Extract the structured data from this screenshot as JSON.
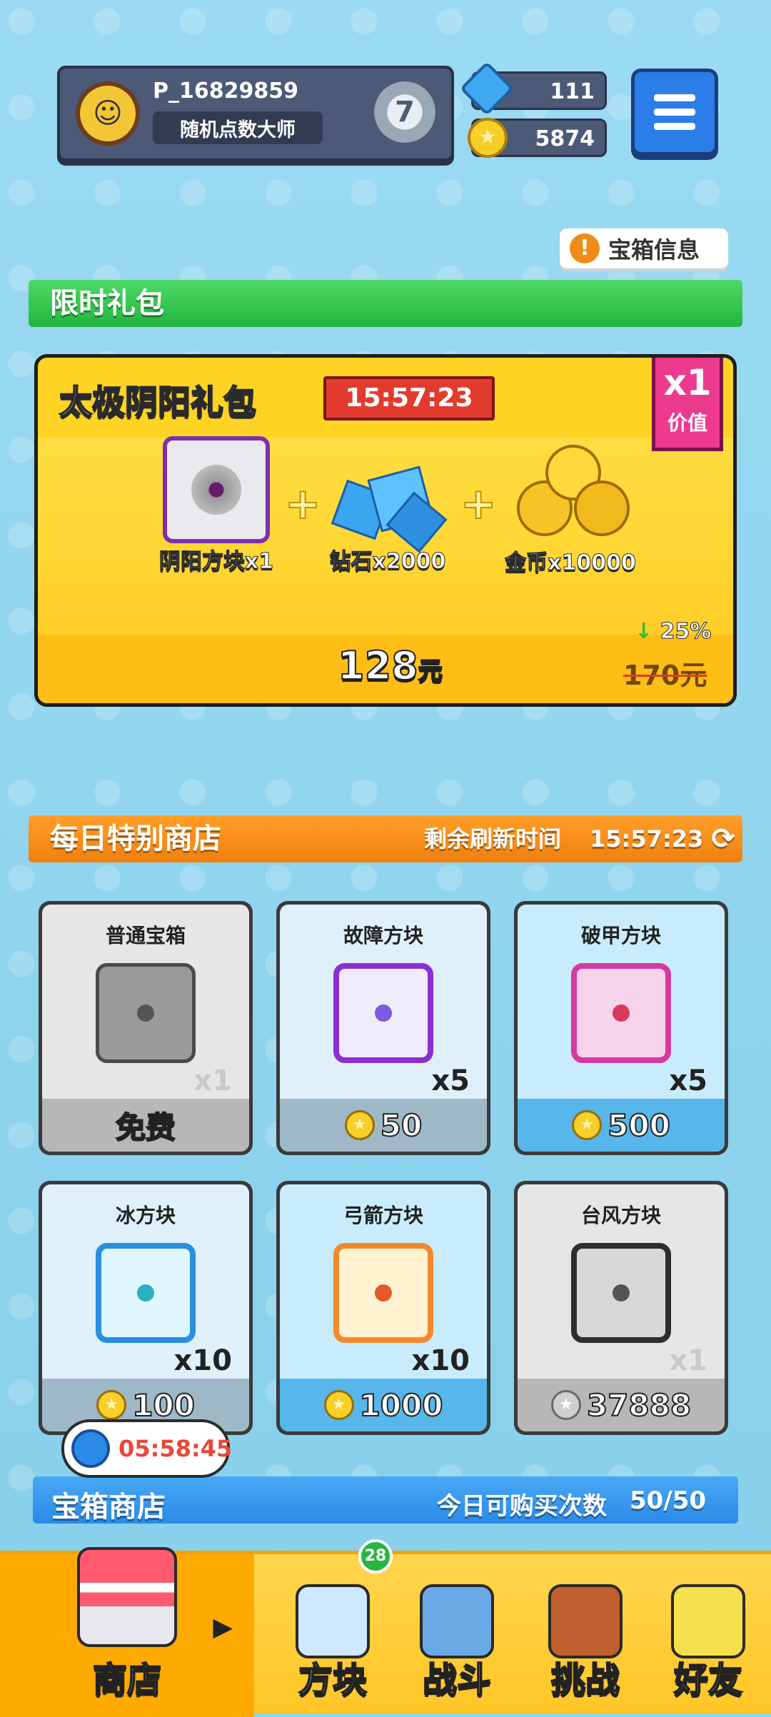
{
  "player": {
    "id": "P_16829859",
    "title": "随机点数大师",
    "rank_level": "7"
  },
  "currency": {
    "gems": "111",
    "coins": "5874"
  },
  "chest_info_button": "宝箱信息",
  "limited_pack": {
    "section_title": "限时礼包",
    "name": "太极阴阳礼包",
    "timer": "15:57:23",
    "value_multiplier": "x1",
    "value_label": "价值",
    "items": [
      {
        "label": "阴阳方块x1",
        "icon": "yin-yang-cube-icon"
      },
      {
        "label": "钻石x2000",
        "icon": "diamond-pile-icon"
      },
      {
        "label": "金币x10000",
        "icon": "gold-coin-pile-icon"
      }
    ],
    "price": "128",
    "price_unit": "元",
    "old_price": "170",
    "old_price_unit": "元",
    "discount": "25%"
  },
  "daily_shop": {
    "section_title": "每日特别商店",
    "refresh_label": "剩余刷新时间",
    "refresh_timer": "15:57:23",
    "items": [
      {
        "name": "普通宝箱",
        "qty": "x1",
        "price": "免费",
        "currency": "none",
        "icon": "common-chest-icon",
        "color": "#e6e6e6",
        "strip": "#b7b7b7"
      },
      {
        "name": "故障方块",
        "qty": "x5",
        "price": "50",
        "currency": "coin",
        "icon": "glitch-cube-icon",
        "color": "#dff0fa",
        "strip": "#9fb8c8"
      },
      {
        "name": "破甲方块",
        "qty": "x5",
        "price": "500",
        "currency": "coin",
        "icon": "armor-break-cube-icon",
        "color": "#c8ecfb",
        "strip": "#57b6ea"
      },
      {
        "name": "冰方块",
        "qty": "x10",
        "price": "100",
        "currency": "coin",
        "icon": "ice-cube-icon",
        "color": "#dff0fa",
        "strip": "#9fb8c8"
      },
      {
        "name": "弓箭方块",
        "qty": "x10",
        "price": "1000",
        "currency": "coin",
        "icon": "bow-cube-icon",
        "color": "#c8ecfb",
        "strip": "#57b6ea"
      },
      {
        "name": "台风方块",
        "qty": "x1",
        "price": "37888",
        "currency": "silver-coin",
        "icon": "typhoon-cube-icon",
        "color": "#e6e6e6",
        "strip": "#b7b7b7"
      }
    ]
  },
  "chest_shop": {
    "section_title": "宝箱商店",
    "purchase_label": "今日可购买次数",
    "purchase_count": "50/50",
    "timer": "05:58:45"
  },
  "nav": {
    "items": [
      {
        "label": "商店",
        "icon": "shop-icon",
        "active": true
      },
      {
        "label": "方块",
        "icon": "cubes-icon",
        "badge": "28"
      },
      {
        "label": "战斗",
        "icon": "battle-icon"
      },
      {
        "label": "挑战",
        "icon": "challenge-icon"
      },
      {
        "label": "好友",
        "icon": "friends-icon"
      }
    ]
  },
  "colors": {
    "green_bar": "#2bc04a",
    "orange_bar": "#f28a12",
    "blue_bar": "#2a8ae8",
    "gold": "#ffd323",
    "pink_tag": "#ec3b8f"
  }
}
